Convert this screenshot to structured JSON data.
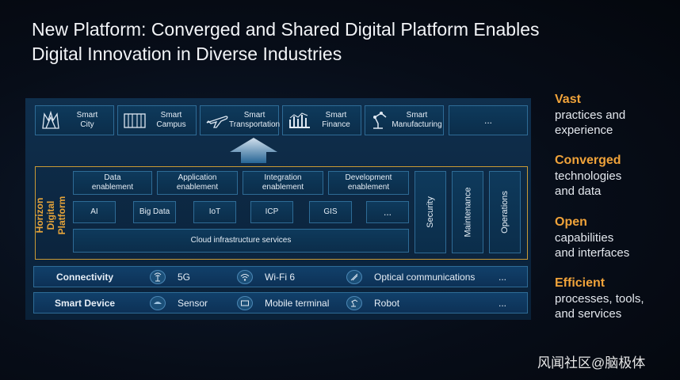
{
  "title": {
    "line1": "New Platform: Converged and Shared Digital Platform Enables",
    "line2": "Digital Innovation in Diverse Industries"
  },
  "industries": [
    {
      "label": "Smart\nCity",
      "icon": "city-icon"
    },
    {
      "label": "Smart\nCampus",
      "icon": "campus-icon"
    },
    {
      "label": "Smart\nTransportation",
      "icon": "airplane-icon"
    },
    {
      "label": "Smart\nFinance",
      "icon": "finance-icon"
    },
    {
      "label": "Smart\nManufacturing",
      "icon": "robot-arm-icon"
    },
    {
      "label": "...",
      "icon": ""
    }
  ],
  "horizon": {
    "label": "Horizon\nDigital Platform",
    "enablement": [
      "Data\nenablement",
      "Application\nenablement",
      "Integration\nenablement",
      "Development\nenablement"
    ],
    "tech": [
      "AI",
      "Big Data",
      "IoT",
      "ICP",
      "GIS",
      "..."
    ],
    "cloud": "Cloud infrastructure  services",
    "vertical": [
      "Security",
      "Maintenance",
      "Operations"
    ]
  },
  "connectivity": {
    "label": "Connectivity",
    "items": [
      "5G",
      "Wi-Fi 6",
      "Optical communications",
      "..."
    ],
    "icons": [
      "antenna-icon",
      "wifi-icon",
      "optical-fiber-icon"
    ]
  },
  "smart_device": {
    "label": "Smart Device",
    "items": [
      "Sensor",
      "Mobile terminal",
      "Robot",
      "..."
    ],
    "icons": [
      "sensor-icon",
      "mobile-terminal-icon",
      "robot-icon"
    ]
  },
  "side": [
    {
      "head": "Vast",
      "body": "practices and\nexperience"
    },
    {
      "head": "Converged",
      "body": "technologies\nand data"
    },
    {
      "head": "Open",
      "body": "capabilities\nand interfaces"
    },
    {
      "head": "Efficient",
      "body": "processes, tools,\nand services"
    }
  ],
  "watermark": "风闻社区@脑极体",
  "colors": {
    "accent": "#f0a33a",
    "border_gold": "#c99a35",
    "panel": "#0c2640",
    "box_border": "#2e6b96"
  }
}
